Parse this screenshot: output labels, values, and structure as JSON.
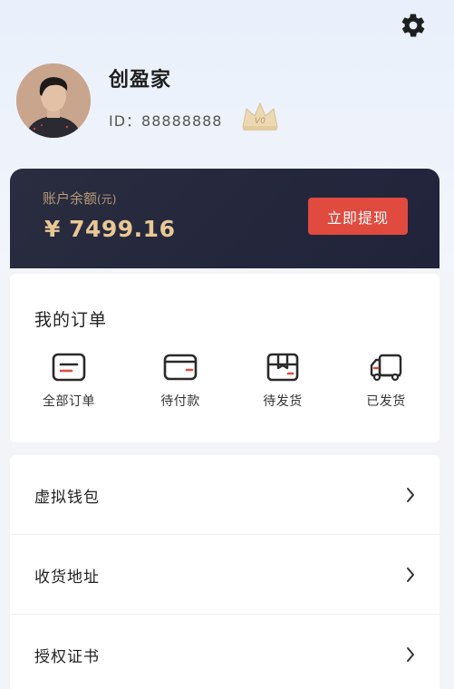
{
  "header": {
    "settings_icon": "gear-icon"
  },
  "profile": {
    "username": "创盈家",
    "id_label": "ID：88888888",
    "vip_badge": "V0"
  },
  "balance": {
    "label": "账户余额",
    "unit": "(元)",
    "amount": "¥ 7499.16",
    "withdraw_button": "立即提现"
  },
  "orders": {
    "title": "我的订单",
    "items": [
      {
        "label": "全部订单",
        "icon": "order-list-icon"
      },
      {
        "label": "待付款",
        "icon": "wallet-icon"
      },
      {
        "label": "待发货",
        "icon": "package-icon"
      },
      {
        "label": "已发货",
        "icon": "truck-icon"
      }
    ]
  },
  "menu": {
    "items": [
      {
        "label": "虚拟钱包"
      },
      {
        "label": "收货地址"
      },
      {
        "label": "授权证书"
      }
    ]
  },
  "colors": {
    "accent_red": "#e04a3f",
    "card_dark": "#242739",
    "gold_text": "#e9c895"
  }
}
